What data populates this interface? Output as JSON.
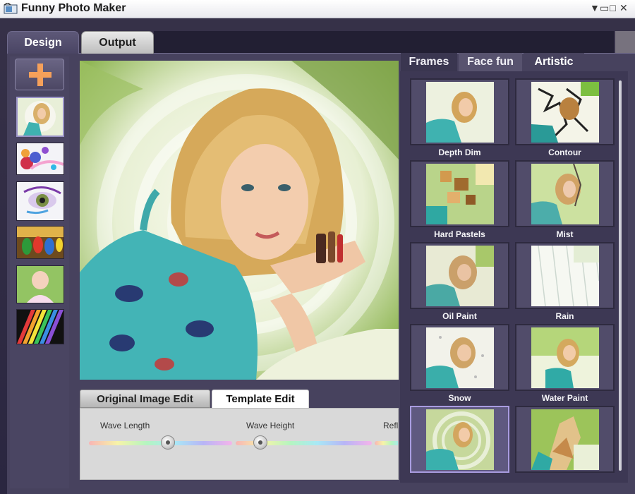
{
  "window": {
    "title": "Funny Photo Maker",
    "controls": [
      "▼",
      "▭",
      "□",
      "✕"
    ]
  },
  "main_tabs": [
    {
      "label": "Design",
      "active": true
    },
    {
      "label": "Output",
      "active": false
    }
  ],
  "sidebar": {
    "add_icon": "plus-icon",
    "thumbnails": [
      {
        "name": "portrait",
        "selected": true
      },
      {
        "name": "flowers",
        "selected": false
      },
      {
        "name": "eye",
        "selected": false
      },
      {
        "name": "parrots",
        "selected": false
      },
      {
        "name": "baby",
        "selected": false
      },
      {
        "name": "rainbow",
        "selected": false
      }
    ]
  },
  "edit_tabs": [
    {
      "label": "Original Image Edit",
      "active": false
    },
    {
      "label": "Template Edit",
      "active": true
    }
  ],
  "sliders": [
    {
      "label": "Wave Length",
      "value": 0.55
    },
    {
      "label": "Wave Height",
      "value": 0.18
    },
    {
      "label": "Refl",
      "value": 0.0
    }
  ],
  "effect_tabs": [
    {
      "label": "Frames",
      "active": false
    },
    {
      "label": "Face fun",
      "active": false
    },
    {
      "label": "Artistic",
      "active": true
    }
  ],
  "effects": [
    {
      "label": "Depth Dim",
      "selected": false
    },
    {
      "label": "Contour",
      "selected": false
    },
    {
      "label": "Hard Pastels",
      "selected": false
    },
    {
      "label": "Mist",
      "selected": false
    },
    {
      "label": "Oil Paint",
      "selected": false
    },
    {
      "label": "Rain",
      "selected": false
    },
    {
      "label": "Snow",
      "selected": false
    },
    {
      "label": "Water Paint",
      "selected": false
    },
    {
      "label": "",
      "selected": true
    },
    {
      "label": "",
      "selected": false
    }
  ],
  "colors": {
    "frame": "#2e2a42",
    "panel": "#47425e",
    "accent": "#a99ce0",
    "plus": "#f5a05a"
  }
}
